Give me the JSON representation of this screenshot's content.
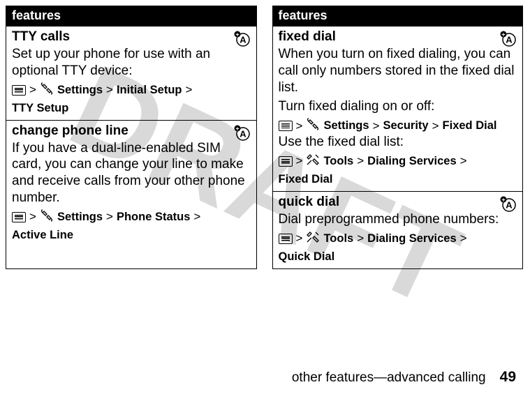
{
  "watermark": "DRAFT",
  "left": {
    "header": "features",
    "blocks": [
      {
        "title": "TTY calls",
        "desc": "Set up your phone for use with an optional TTY device:",
        "patha": "Settings",
        "pathb": "Initial Setup",
        "pathc": "TTY Setup",
        "path_icon_b": "wrench"
      },
      {
        "title": "change phone line",
        "desc": "If you have a dual-line-enabled SIM card, you can change your line to make and receive calls from your other phone number.",
        "patha": "Settings",
        "pathb": "Phone Status",
        "pathc": "Active Line",
        "path_icon_b": "wrench"
      }
    ]
  },
  "right": {
    "header": "features",
    "blocks": [
      {
        "title": "fixed dial",
        "desc": "When you turn on fixed dialing, you can call only numbers stored in the fixed dial list.",
        "desc2": "Turn fixed dialing on or off:",
        "patha": "Settings",
        "pathb": "Security",
        "pathc": "Fixed Dial",
        "path_icon_b": "wrench",
        "desc3": "Use the fixed dial list:",
        "path2a": "Tools",
        "path2b": "Dialing Services",
        "path2c": "Fixed Dial",
        "path2_icon_b": "tools"
      },
      {
        "title": "quick dial",
        "desc": "Dial preprogrammed phone numbers:",
        "patha": "Tools",
        "pathb": "Dialing Services",
        "pathc": "Quick Dial",
        "path_icon_b": "tools"
      }
    ]
  },
  "footer": {
    "section": "other features—advanced calling",
    "page": "49"
  }
}
